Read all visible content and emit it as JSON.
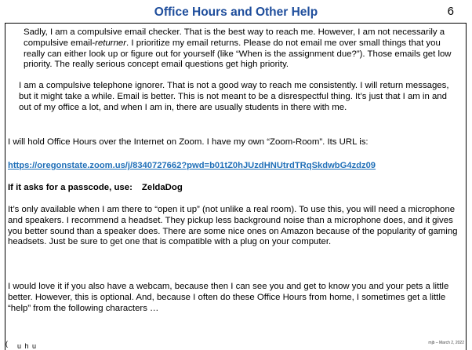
{
  "slide": {
    "title": "Office Hours and Other Help",
    "page_number": "6",
    "p1_pre": "Sadly, I am a compulsive email checker.  That is the best way to reach me.  However, I am not necessarily a compulsive email-",
    "p1_em": "returner",
    "p1_post": ".  I prioritize my email returns.  Please do not email me over small things that you really can either look up or figure out for yourself (like “When is the assignment due?”). Those emails get low priority.  The really serious concept email questions get high priority.",
    "p2": "I am a compulsive telephone ignorer.  That is not a good way to reach me consistently.  I will return messages, but it might take a while.  Email is better.  This is not meant to be a disrespectful thing.  It’s just that I am in and out of my office a lot, and when I am in, there are usually students in there with me.",
    "p3": "I will hold Office Hours over the Internet on Zoom.  I have my own “Zoom-Room”.  Its URL is:",
    "zoom_url": "https://oregonstate.zoom.us/j/8340727662?pwd=b01tZ0hJUzdHNUtrdTRqSkdwbG4zdz09",
    "passcode_label": "If it asks for a passcode, use:",
    "passcode_value": "ZeldaDog",
    "p4": "It’s only available when I am there to “open it up” (not unlike a real room). To use this, you will need a microphone and speakers.  I recommend a headset.  They pickup less background noise than a microphone does, and it gives you better sound than a speaker does.  There are some nice ones on Amazon because of the popularity of gaming headsets.  Just be sure to get one that is compatible with a plug on your computer.",
    "p5": "I would love it if you also have a webcam, because then I can see you and get to know you and your pets a little better.  However, this is optional.  And, because I often do these Office Hours from home, I sometimes get a little “help” from the following characters …",
    "footer_mark": "(",
    "footer_text": "u h   u",
    "footer_credit": "mjb – March 2, 2022"
  },
  "colors": {
    "title": "#1f4e9c",
    "link": "#1f6fb8"
  }
}
